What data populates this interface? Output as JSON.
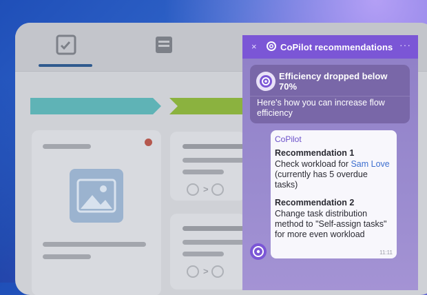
{
  "panel": {
    "close_glyph": "×",
    "title": "CoPilot recommendations",
    "more_glyph": "···"
  },
  "alert": {
    "title": "Efficiency dropped below 70%",
    "text": "Here's how you can increase flow efficiency"
  },
  "message": {
    "sender": "CoPilot",
    "rec1_title": "Recommendation 1",
    "rec1_pre": "Check workload for ",
    "rec1_link": "Sam Love",
    "rec1_post": " (currently has 5 overdue tasks)",
    "rec2_title": "Recommendation 2",
    "rec2_text": "Change task distribution method to \"Self-assign tasks\" for more even workload",
    "time": "11:11"
  },
  "background": {
    "arrow_1": ">",
    "arrow_2": ">"
  },
  "icons": [
    "checklist-icon",
    "window-icon",
    "image-icon",
    "copilot-logo-icon",
    "user-icon",
    "notification-dot"
  ],
  "colors": {
    "accent": "#7b56d6",
    "stage_teal": "#5fb3b6",
    "stage_green": "#8bb23f",
    "link": "#3d6fcf"
  }
}
